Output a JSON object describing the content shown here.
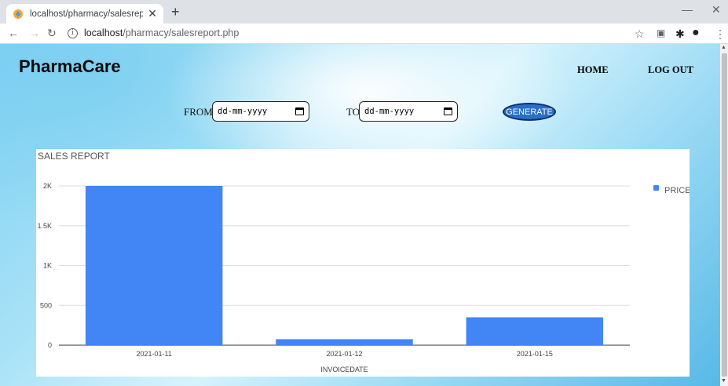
{
  "browser": {
    "tab_title": "localhost/pharmacy/salesreport.p",
    "url_host": "localhost",
    "url_path": "/pharmacy/salesreport.php"
  },
  "page": {
    "brand": "PharmaCare",
    "nav": {
      "home": "HOME",
      "logout": "LOG OUT"
    },
    "filter": {
      "from_label": "FROM",
      "to_label": "TO",
      "from_placeholder": "dd-mm-yyyy",
      "to_placeholder": "dd-mm-yyyy",
      "generate_label": "GENERATE"
    }
  },
  "colors": {
    "bar": "#4285f4",
    "button": "#2a6fc6"
  },
  "chart_data": {
    "type": "bar",
    "title": "SALES REPORT",
    "xlabel": "INVOICEDATE",
    "ylabel": "",
    "categories": [
      "2021-01-11",
      "2021-01-12",
      "2021-01-15"
    ],
    "series": [
      {
        "name": "PRICE",
        "values": [
          2000,
          75,
          350
        ]
      }
    ],
    "ylim": [
      0,
      2000
    ],
    "yticks": [
      0,
      500,
      1000,
      1500,
      2000
    ],
    "ytick_labels": [
      "0",
      "500",
      "1K",
      "1.5K",
      "2K"
    ],
    "grid": true,
    "legend_position": "right"
  }
}
